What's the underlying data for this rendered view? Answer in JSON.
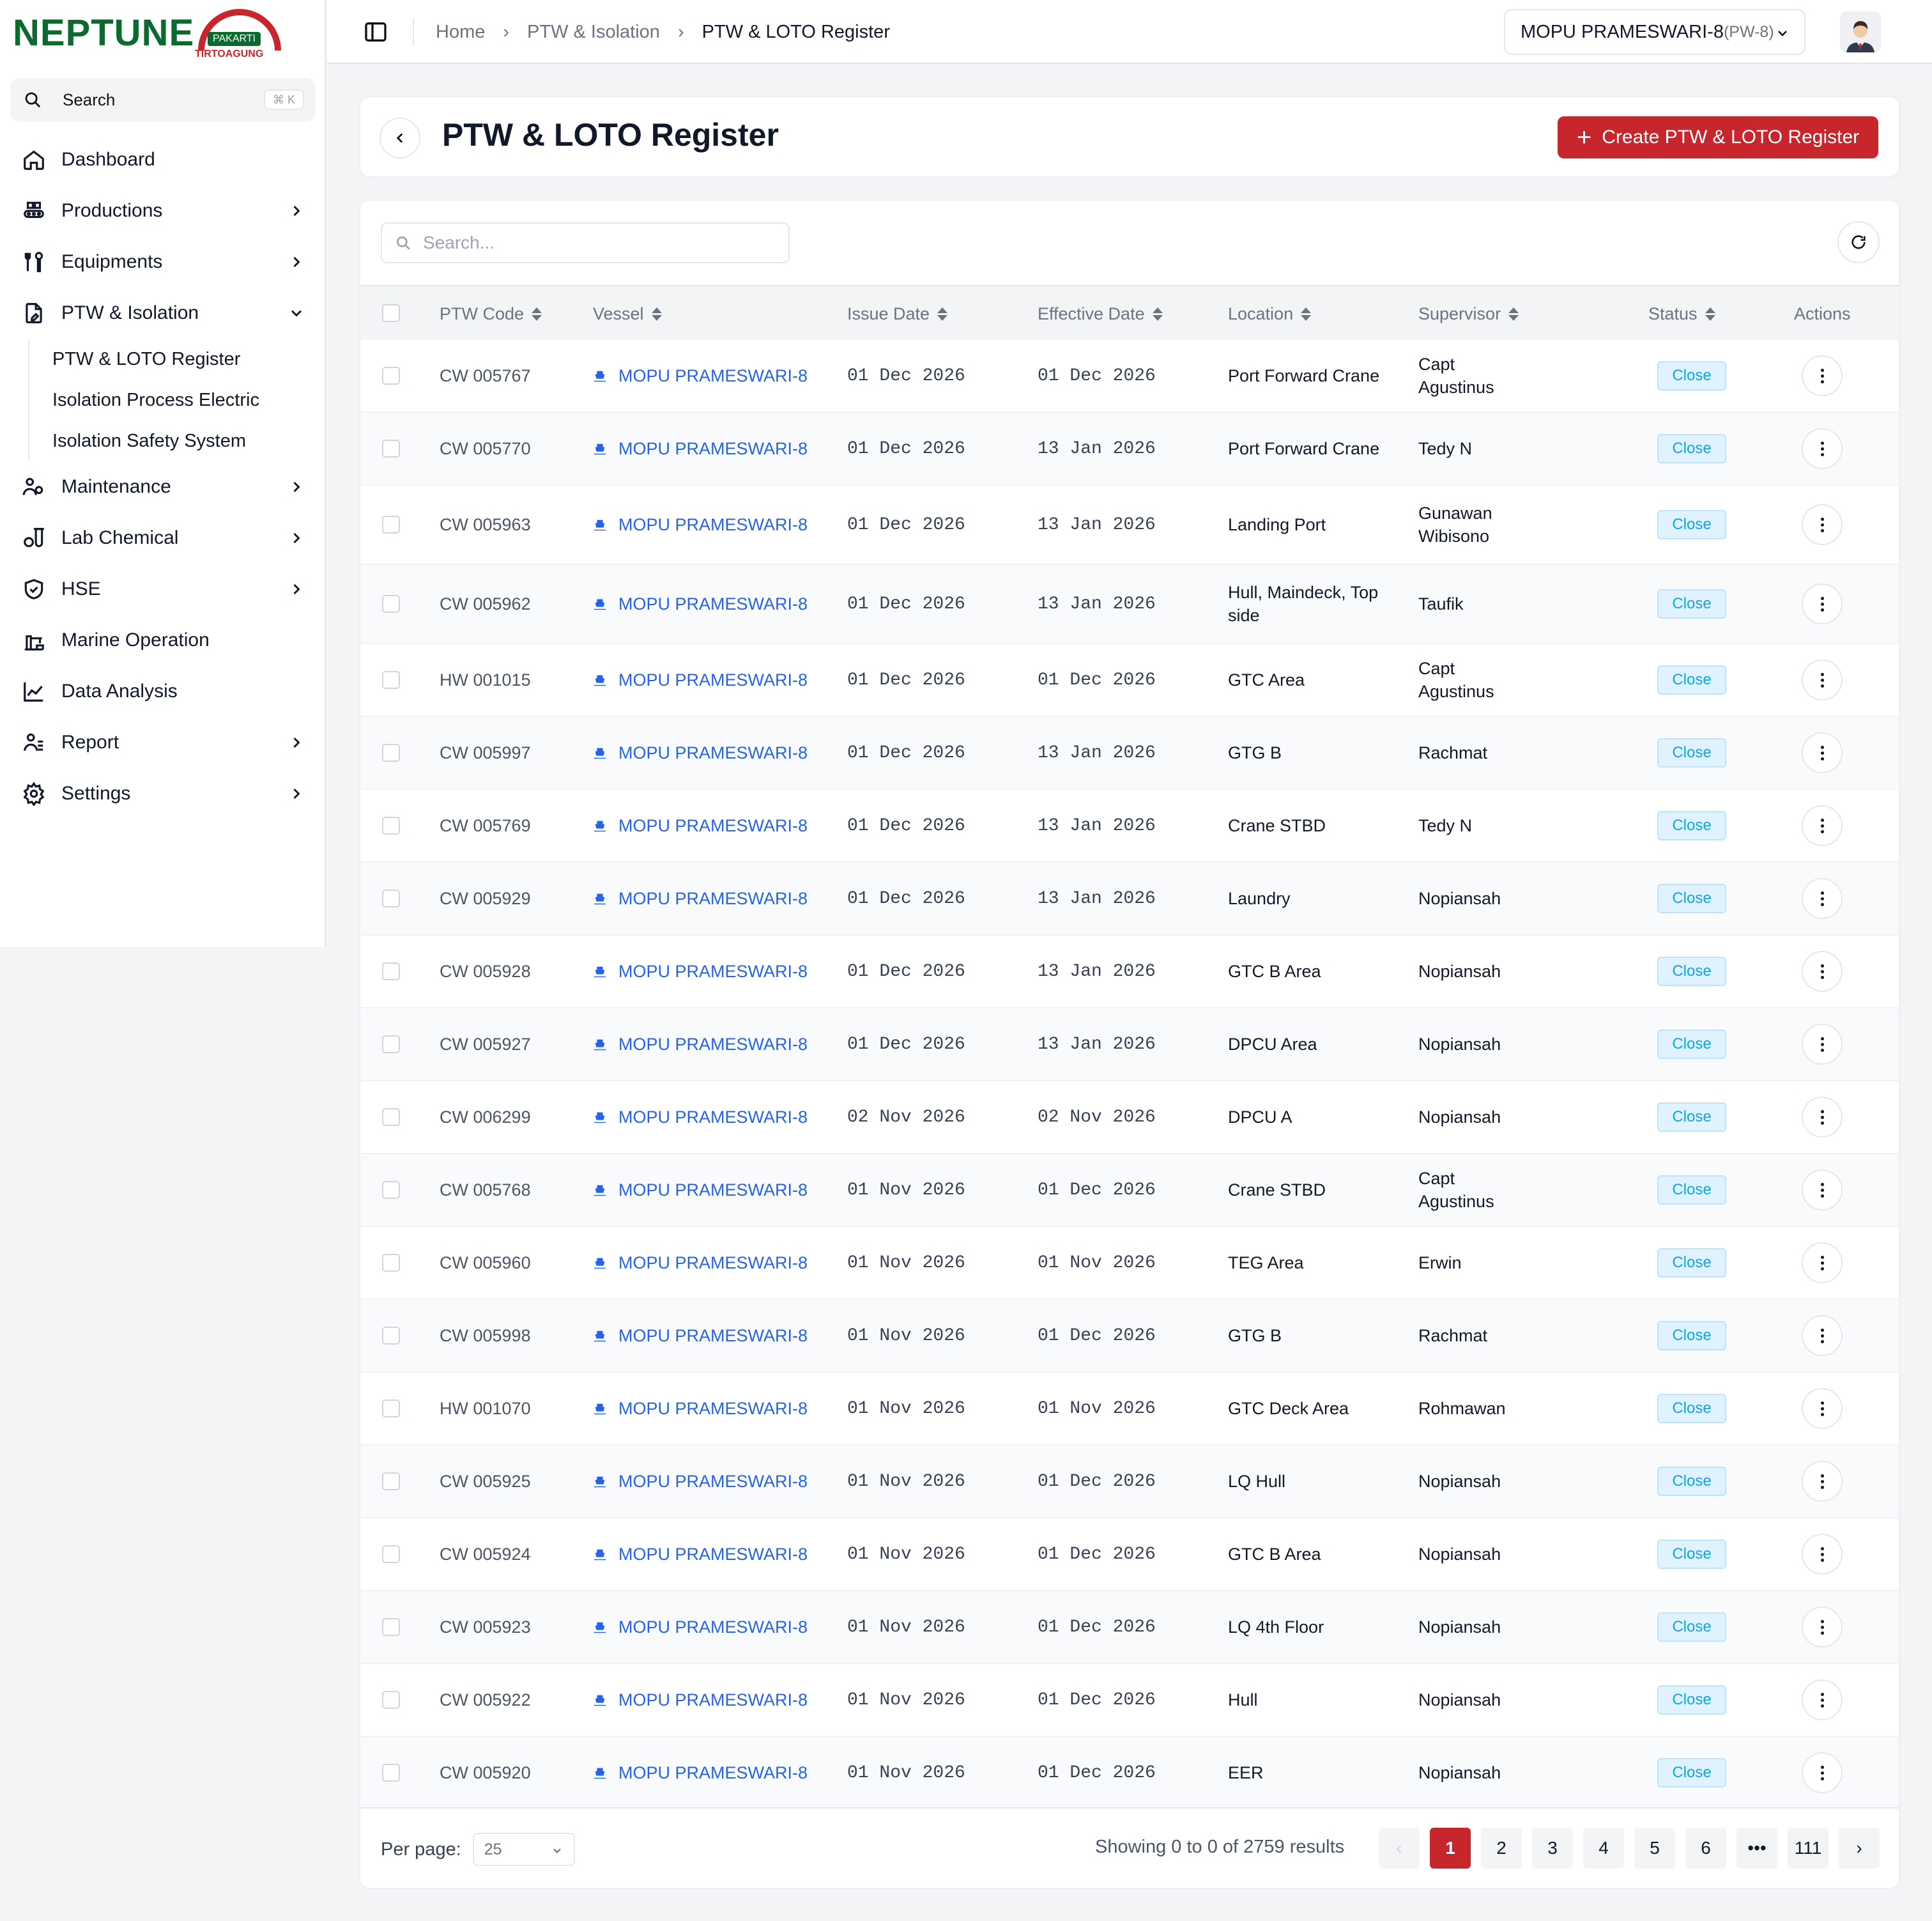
{
  "brand": {
    "name": "NEPTUNE",
    "tag1": "PAKARTI",
    "tag2": "TIRTOAGUNG"
  },
  "search": {
    "placeholder": "Search",
    "shortcut": "⌘ K"
  },
  "sidebar": {
    "items": [
      {
        "label": "Dashboard",
        "icon": "home-icon"
      },
      {
        "label": "Productions",
        "icon": "production-icon"
      },
      {
        "label": "Equipments",
        "icon": "tools-icon"
      },
      {
        "label": "PTW & Isolation",
        "icon": "document-icon"
      },
      {
        "label": "Maintenance",
        "icon": "users-gear-icon"
      },
      {
        "label": "Lab Chemical",
        "icon": "flask-icon"
      },
      {
        "label": "HSE",
        "icon": "shield-icon"
      },
      {
        "label": "Marine Operation",
        "icon": "crane-icon"
      },
      {
        "label": "Data Analysis",
        "icon": "chart-icon"
      },
      {
        "label": "Report",
        "icon": "report-icon"
      },
      {
        "label": "Settings",
        "icon": "gear-icon"
      }
    ],
    "sub_items": [
      "PTW & LOTO Register",
      "Isolation Process Electric",
      "Isolation Safety System"
    ]
  },
  "breadcrumb": [
    "Home",
    "PTW & Isolation",
    "PTW & LOTO Register"
  ],
  "vessel_selector": {
    "name": "MOPU PRAMESWARI-8",
    "code": "(PW-8)"
  },
  "page": {
    "title": "PTW & LOTO Register",
    "create_label": "Create PTW & LOTO Register"
  },
  "table": {
    "search_placeholder": "Search...",
    "columns": [
      "PTW Code",
      "Vessel",
      "Issue Date",
      "Effective Date",
      "Location",
      "Supervisor",
      "Status",
      "Actions"
    ],
    "rows": [
      {
        "code": "CW 005767",
        "vessel": "MOPU PRAMESWARI-8",
        "issue": "01 Dec 2026",
        "effective": "01 Dec 2026",
        "location": "Port Forward Crane",
        "supervisor": "Capt Agustinus",
        "status": "Close"
      },
      {
        "code": "CW 005770",
        "vessel": "MOPU PRAMESWARI-8",
        "issue": "01 Dec 2026",
        "effective": "13 Jan 2026",
        "location": "Port Forward Crane",
        "supervisor": "Tedy N",
        "status": "Close"
      },
      {
        "code": "CW 005963",
        "vessel": "MOPU PRAMESWARI-8",
        "issue": "01 Dec 2026",
        "effective": "13 Jan 2026",
        "location": "Landing Port",
        "supervisor": "Gunawan Wibisono",
        "status": "Close"
      },
      {
        "code": "CW 005962",
        "vessel": "MOPU PRAMESWARI-8",
        "issue": "01 Dec 2026",
        "effective": "13 Jan 2026",
        "location": "Hull, Maindeck, Top side",
        "supervisor": "Taufik",
        "status": "Close"
      },
      {
        "code": "HW 001015",
        "vessel": "MOPU PRAMESWARI-8",
        "issue": "01 Dec 2026",
        "effective": "01 Dec 2026",
        "location": "GTC Area",
        "supervisor": "Capt Agustinus",
        "status": "Close"
      },
      {
        "code": "CW 005997",
        "vessel": "MOPU PRAMESWARI-8",
        "issue": "01 Dec 2026",
        "effective": "13 Jan 2026",
        "location": "GTG B",
        "supervisor": "Rachmat",
        "status": "Close"
      },
      {
        "code": "CW 005769",
        "vessel": "MOPU PRAMESWARI-8",
        "issue": "01 Dec 2026",
        "effective": "13 Jan 2026",
        "location": "Crane STBD",
        "supervisor": "Tedy N",
        "status": "Close"
      },
      {
        "code": "CW 005929",
        "vessel": "MOPU PRAMESWARI-8",
        "issue": "01 Dec 2026",
        "effective": "13 Jan 2026",
        "location": "Laundry",
        "supervisor": "Nopiansah",
        "status": "Close"
      },
      {
        "code": "CW 005928",
        "vessel": "MOPU PRAMESWARI-8",
        "issue": "01 Dec 2026",
        "effective": "13 Jan 2026",
        "location": "GTC B Area",
        "supervisor": "Nopiansah",
        "status": "Close"
      },
      {
        "code": "CW 005927",
        "vessel": "MOPU PRAMESWARI-8",
        "issue": "01 Dec 2026",
        "effective": "13 Jan 2026",
        "location": "DPCU Area",
        "supervisor": "Nopiansah",
        "status": "Close"
      },
      {
        "code": "CW 006299",
        "vessel": "MOPU PRAMESWARI-8",
        "issue": "02 Nov 2026",
        "effective": "02 Nov 2026",
        "location": "DPCU A",
        "supervisor": "Nopiansah",
        "status": "Close"
      },
      {
        "code": "CW 005768",
        "vessel": "MOPU PRAMESWARI-8",
        "issue": "01 Nov 2026",
        "effective": "01 Dec 2026",
        "location": "Crane STBD",
        "supervisor": "Capt Agustinus",
        "status": "Close"
      },
      {
        "code": "CW 005960",
        "vessel": "MOPU PRAMESWARI-8",
        "issue": "01 Nov 2026",
        "effective": "01 Nov 2026",
        "location": "TEG Area",
        "supervisor": "Erwin",
        "status": "Close"
      },
      {
        "code": "CW 005998",
        "vessel": "MOPU PRAMESWARI-8",
        "issue": "01 Nov 2026",
        "effective": "01 Dec 2026",
        "location": "GTG B",
        "supervisor": "Rachmat",
        "status": "Close"
      },
      {
        "code": "HW 001070",
        "vessel": "MOPU PRAMESWARI-8",
        "issue": "01 Nov 2026",
        "effective": "01 Nov 2026",
        "location": "GTC Deck Area",
        "supervisor": "Rohmawan",
        "status": "Close"
      },
      {
        "code": "CW 005925",
        "vessel": "MOPU PRAMESWARI-8",
        "issue": "01 Nov 2026",
        "effective": "01 Dec 2026",
        "location": "LQ Hull",
        "supervisor": "Nopiansah",
        "status": "Close"
      },
      {
        "code": "CW 005924",
        "vessel": "MOPU PRAMESWARI-8",
        "issue": "01 Nov 2026",
        "effective": "01 Dec 2026",
        "location": "GTC B Area",
        "supervisor": "Nopiansah",
        "status": "Close"
      },
      {
        "code": "CW 005923",
        "vessel": "MOPU PRAMESWARI-8",
        "issue": "01 Nov 2026",
        "effective": "01 Dec 2026",
        "location": "LQ 4th Floor",
        "supervisor": "Nopiansah",
        "status": "Close"
      },
      {
        "code": "CW 005922",
        "vessel": "MOPU PRAMESWARI-8",
        "issue": "01 Nov 2026",
        "effective": "01 Dec 2026",
        "location": "Hull",
        "supervisor": "Nopiansah",
        "status": "Close"
      },
      {
        "code": "CW 005920",
        "vessel": "MOPU PRAMESWARI-8",
        "issue": "01 Nov 2026",
        "effective": "01 Dec 2026",
        "location": "EER",
        "supervisor": "Nopiansah",
        "status": "Close"
      }
    ]
  },
  "pagination": {
    "per_page_label": "Per page:",
    "per_page_value": "25",
    "showing": "Showing 0 to 0 of 2759 results",
    "pages": [
      "1",
      "2",
      "3",
      "4",
      "5",
      "6",
      "•••",
      "111"
    ],
    "current": "1"
  },
  "colors": {
    "accent": "#c8262d",
    "link": "#2563eb",
    "brand_green": "#0b6b2f"
  }
}
